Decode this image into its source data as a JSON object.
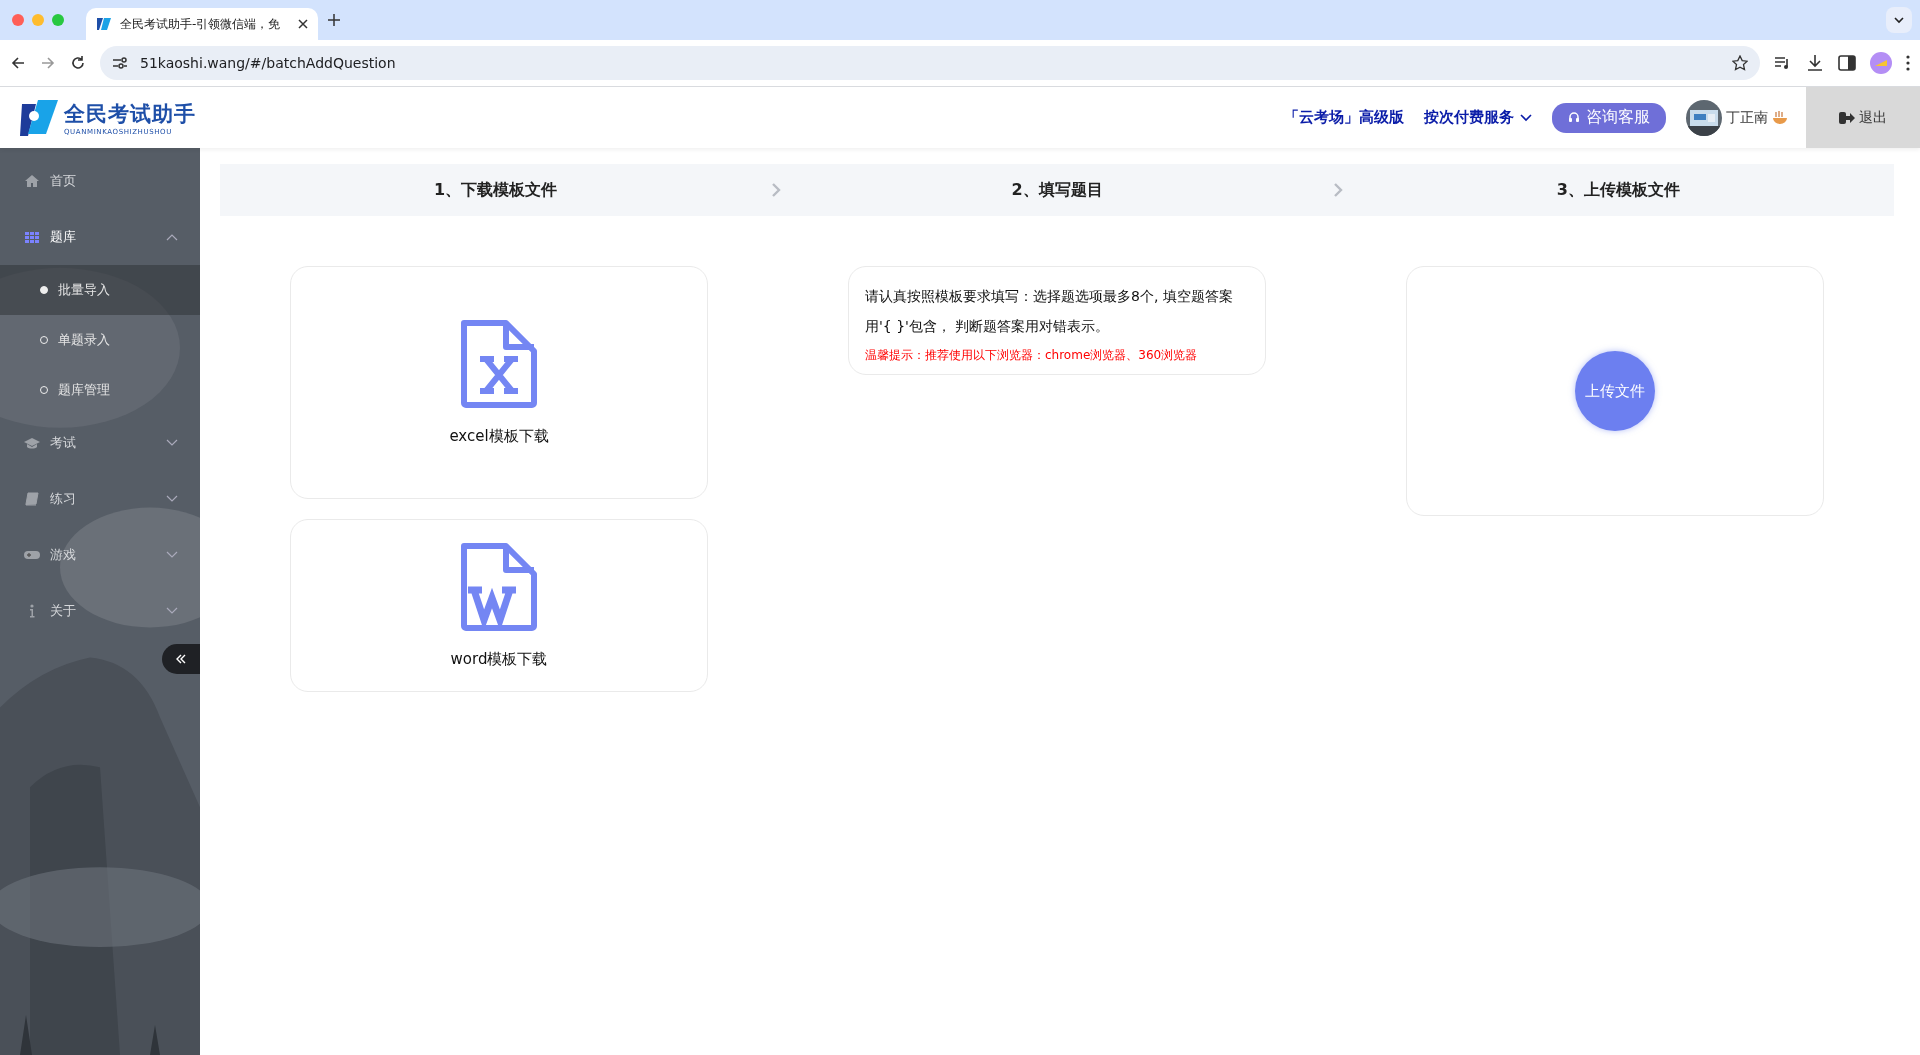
{
  "browser": {
    "tab_title": "全民考试助手-引领微信端，免",
    "url": "51kaoshi.wang/#/batchAddQuestion"
  },
  "header": {
    "logo_title": "全民考试助手",
    "logo_subtitle": "QUANMINKAOSHIZHUSHOU",
    "plan": "「云考场」高级版",
    "service_menu": "按次付费服务",
    "consult_button": "咨询客服",
    "user_name": "丁正南",
    "logout": "退出"
  },
  "sidebar": {
    "items": [
      {
        "label": "首页",
        "kind": "link",
        "selected": false
      },
      {
        "label": "题库",
        "kind": "group",
        "selected": true,
        "expanded": true,
        "children": [
          {
            "label": "批量导入",
            "selected": true
          },
          {
            "label": "单题录入",
            "selected": false
          },
          {
            "label": "题库管理",
            "selected": false
          }
        ]
      },
      {
        "label": "考试",
        "kind": "group",
        "selected": false,
        "expanded": false
      },
      {
        "label": "练习",
        "kind": "group",
        "selected": false,
        "expanded": false
      },
      {
        "label": "游戏",
        "kind": "group",
        "selected": false,
        "expanded": false
      },
      {
        "label": "关于",
        "kind": "group",
        "selected": false,
        "expanded": false
      }
    ]
  },
  "steps": [
    {
      "label": "1、下载模板文件"
    },
    {
      "label": "2、填写题目"
    },
    {
      "label": "3、上传模板文件"
    }
  ],
  "downloads": [
    {
      "label": "excel模板下载"
    },
    {
      "label": "word模板下载"
    }
  ],
  "notice": {
    "text": "请认真按照模板要求填写：选择题选项最多8个, 填空题答案用'{ }'包含， 判断题答案用对错表示。",
    "tip": "温馨提示：推荐使用以下浏览器：chrome浏览器、360浏览器"
  },
  "upload_button": "上传文件"
}
